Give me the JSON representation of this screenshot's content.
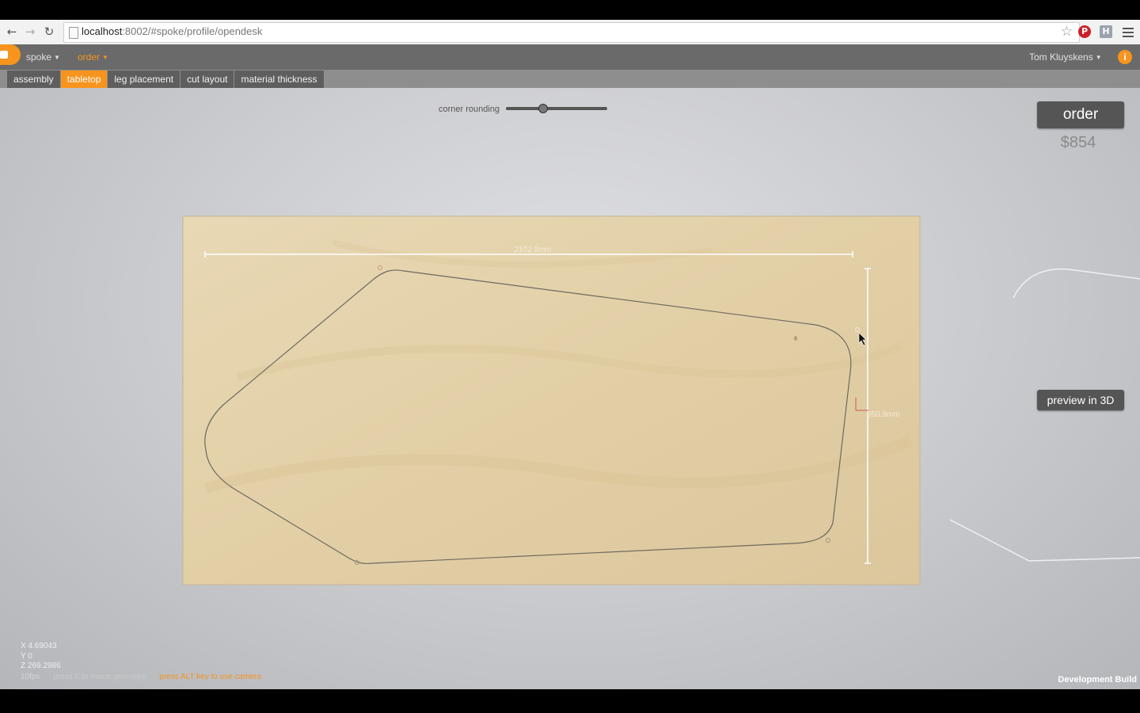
{
  "browser": {
    "url_host": "localhost",
    "url_rest": ":8002/#spoke/profile/opendesk"
  },
  "app": {
    "menu_spoke": "spoke",
    "menu_order": "order",
    "user_name": "Tom Kluyskens",
    "info_glyph": "i",
    "tabs": [
      {
        "label": "assembly",
        "active": false
      },
      {
        "label": "tabletop",
        "active": true
      },
      {
        "label": "leg placement",
        "active": false
      },
      {
        "label": "cut layout",
        "active": false
      },
      {
        "label": "material thickness",
        "active": false
      }
    ],
    "slider": {
      "label": "corner rounding",
      "value": 0.36
    },
    "order_button": "order",
    "price": "$854",
    "preview_button": "preview in 3D",
    "dimensions": {
      "width": "2102.9mm",
      "height": "950.9mm"
    },
    "readouts": {
      "x": "X 4.69043",
      "y": "Y 0",
      "z": "Z 269.2986"
    },
    "footer": {
      "fps": "10fps",
      "hint_frame": "press F to frame geometry",
      "hint_camera": "press ALT key to use camera"
    },
    "dev_build": "Development Build"
  },
  "colors": {
    "accent": "#f7941d",
    "wood": "#e4d3ad",
    "outline": "#6e6a60"
  },
  "icons": {
    "back": "back-arrow-icon",
    "forward": "forward-arrow-icon",
    "reload": "reload-icon",
    "bookmark": "star-icon",
    "pinterest": "pinterest-icon",
    "extension": "h-extension-icon",
    "menu": "hamburger-menu-icon",
    "info": "info-icon"
  }
}
